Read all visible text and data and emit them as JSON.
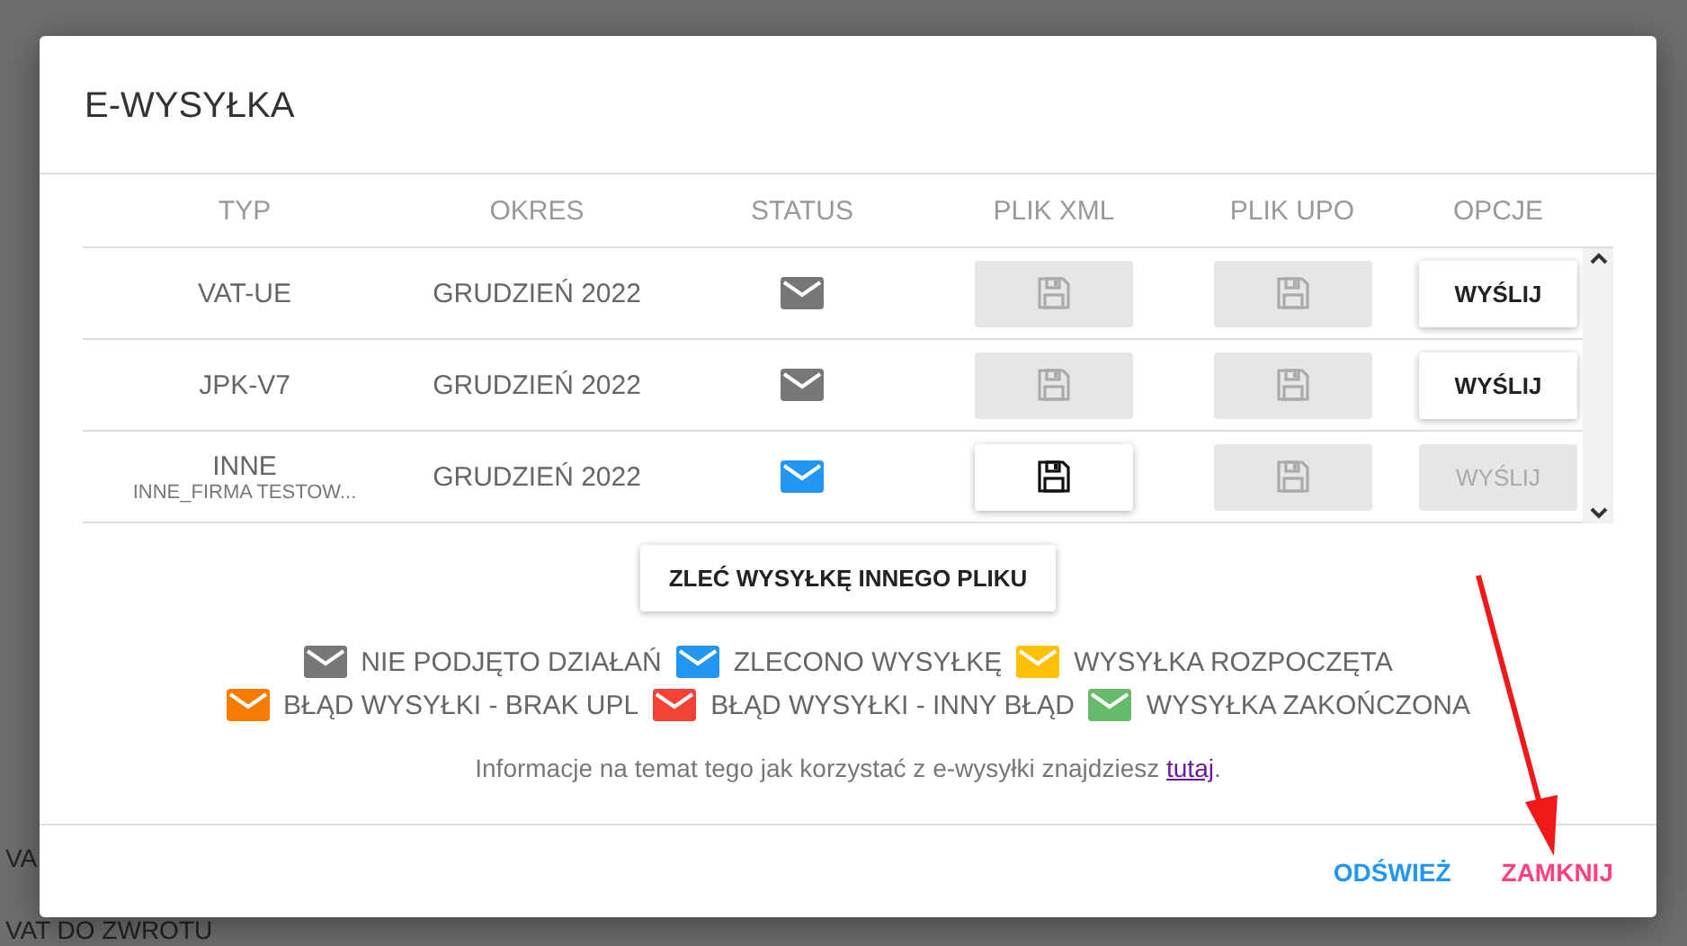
{
  "background_rows": [
    "VA",
    "VAT DO ZWROTU"
  ],
  "dialog": {
    "title": "E-WYSYŁKA"
  },
  "table": {
    "columns": [
      "TYP",
      "OKRES",
      "STATUS",
      "PLIK XML",
      "PLIK UPO",
      "OPCJE"
    ],
    "rows": [
      {
        "type": "VAT-UE",
        "subtitle": "",
        "period": "GRUDZIEŃ 2022",
        "color": "#777777",
        "xml_disabled": true,
        "upo_disabled": true,
        "send": "WYŚLIJ",
        "send_disabled": false
      },
      {
        "type": "JPK-V7",
        "subtitle": "",
        "period": "GRUDZIEŃ 2022",
        "color": "#777777",
        "xml_disabled": true,
        "upo_disabled": true,
        "send": "WYŚLIJ",
        "send_disabled": false
      },
      {
        "type": "INNE",
        "subtitle": "INNE_FIRMA TESTOW...",
        "period": "GRUDZIEŃ 2022",
        "color": "#2196f3",
        "xml_disabled": false,
        "upo_disabled": true,
        "send": "WYŚLIJ",
        "send_disabled": true
      }
    ]
  },
  "other_file_button": "ZLEĆ WYSYŁKĘ INNEGO PLIKU",
  "legend": [
    [
      {
        "label": "NIE PODJĘTO DZIAŁAŃ",
        "color": "#777777"
      },
      {
        "label": "ZLECONO WYSYŁKĘ",
        "color": "#2196f3"
      },
      {
        "label": "WYSYŁKA ROZPOCZĘTA",
        "color": "#ffc107"
      }
    ],
    [
      {
        "label": "BŁĄD WYSYŁKI - BRAK UPL",
        "color": "#f57c00"
      },
      {
        "label": "BŁĄD WYSYŁKI - INNY BŁĄD",
        "color": "#f44336"
      },
      {
        "label": "WYSYŁKA ZAKOŃCZONA",
        "color": "#66bb6a"
      }
    ]
  ],
  "info": {
    "text": "Informacje na temat tego jak korzystać z e-wysyłki znajdziesz",
    "link": "tutaj",
    "end": "."
  },
  "footer_buttons": [
    {
      "label": "ODŚWIEŻ",
      "kind": "primary"
    },
    {
      "label": "ZAMKNIJ",
      "kind": "danger"
    }
  ]
}
